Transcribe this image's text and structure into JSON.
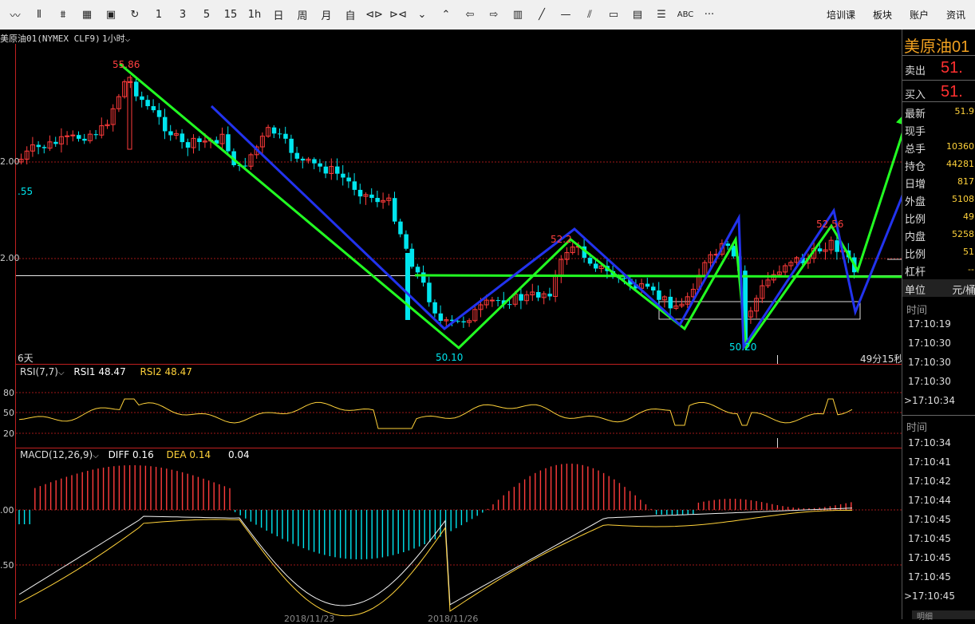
{
  "toolbar": {
    "tools": [
      {
        "icon": "line-chart-icon",
        "label": ""
      },
      {
        "icon": "candlestick-icon",
        "label": ""
      },
      {
        "icon": "bar-chart-icon",
        "label": ""
      },
      {
        "icon": "grid-icon",
        "label": ""
      },
      {
        "icon": "save-icon",
        "label": ""
      },
      {
        "icon": "refresh-icon",
        "label": ""
      },
      {
        "icon": "period-1",
        "label": "1"
      },
      {
        "icon": "period-3",
        "label": "3"
      },
      {
        "icon": "period-5",
        "label": "5"
      },
      {
        "icon": "period-15",
        "label": "15"
      },
      {
        "icon": "period-1h",
        "label": "1h"
      },
      {
        "icon": "period-day",
        "label": "日"
      },
      {
        "icon": "period-week",
        "label": "周"
      },
      {
        "icon": "period-month",
        "label": "月"
      },
      {
        "icon": "period-custom",
        "label": "自"
      },
      {
        "icon": "zoom-in-icon",
        "label": ""
      },
      {
        "icon": "zoom-out-icon",
        "label": ""
      },
      {
        "icon": "chevron-down-double-icon",
        "label": ""
      },
      {
        "icon": "chevron-up-double-icon",
        "label": ""
      },
      {
        "icon": "arrow-left-icon",
        "label": ""
      },
      {
        "icon": "arrow-right-icon",
        "label": ""
      },
      {
        "icon": "layout-icon",
        "label": ""
      },
      {
        "icon": "draw-line-icon",
        "label": ""
      },
      {
        "icon": "horizontal-line-icon",
        "label": ""
      },
      {
        "icon": "parallel-line-icon",
        "label": ""
      },
      {
        "icon": "rectangle-icon",
        "label": ""
      },
      {
        "icon": "text-box-icon",
        "label": ""
      },
      {
        "icon": "list-icon",
        "label": ""
      },
      {
        "icon": "text-abc-icon",
        "label": "ABC"
      },
      {
        "icon": "more-icon",
        "label": "···"
      }
    ],
    "right": [
      "培训课",
      "板块",
      "账户",
      "资讯"
    ]
  },
  "symbol": "美原油01(NYMEX CLF9)",
  "timeframe": "1小时",
  "side": {
    "name": "美原油01",
    "sell_label": "卖出",
    "sell_value": "51.",
    "buy_label": "买入",
    "buy_value": "51.",
    "rows": [
      {
        "k": "最新",
        "v": "51.9"
      },
      {
        "k": "现手",
        "v": ""
      },
      {
        "k": "总手",
        "v": "10360"
      },
      {
        "k": "持仓",
        "v": "44281"
      },
      {
        "k": "日增",
        "v": "817"
      },
      {
        "k": "外盘",
        "v": "5108"
      },
      {
        "k": "比例",
        "v": "49"
      },
      {
        "k": "内盘",
        "v": "5258"
      },
      {
        "k": "比例",
        "v": "51"
      },
      {
        "k": "杠杆",
        "v": "--"
      }
    ],
    "unit_label": "单位",
    "unit_value": "元/桶",
    "time_header": "时间",
    "times1": [
      "17:10:19",
      "17:10:30",
      "17:10:30",
      "17:10:30",
      ">17:10:34"
    ],
    "times2": [
      "17:10:34",
      "17:10:41",
      "17:10:42",
      "17:10:44",
      "17:10:45",
      "17:10:45",
      "17:10:45",
      "17:10:45",
      ">17:10:45"
    ],
    "scroll_label": "明细"
  },
  "main_chart": {
    "high_label": "55.86",
    "low_label1": "50.10",
    "low_label2": "50.20",
    "mid_label1": "52.2",
    "mid_label2": "52.56",
    "left_label": ".55",
    "axis_labels": [
      "2.00",
      "2.00"
    ],
    "period_count": "6天",
    "countdown": "49分15秒"
  },
  "rsi": {
    "title": "RSI(7,7)",
    "rsi1_label": "RSI1",
    "rsi1_value": "48.47",
    "rsi2_label": "RSI2",
    "rsi2_value": "48.47",
    "levels": [
      "80",
      "50",
      "20"
    ]
  },
  "macd": {
    "title": "MACD(12,26,9)",
    "diff_label": "DIFF",
    "diff_value": "0.16",
    "dea_label": "DEA",
    "dea_value": "0.14",
    "macd_value": "0.04",
    "axis_labels": [
      ".00",
      ".50"
    ]
  },
  "dates": [
    "2018/11/23",
    "2018/11/26"
  ],
  "colors": {
    "up": "#ff3b3b",
    "down": "#00e5ee",
    "green": "#22ff22",
    "blue": "#2233ee",
    "yellow": "#ffd23a"
  }
}
